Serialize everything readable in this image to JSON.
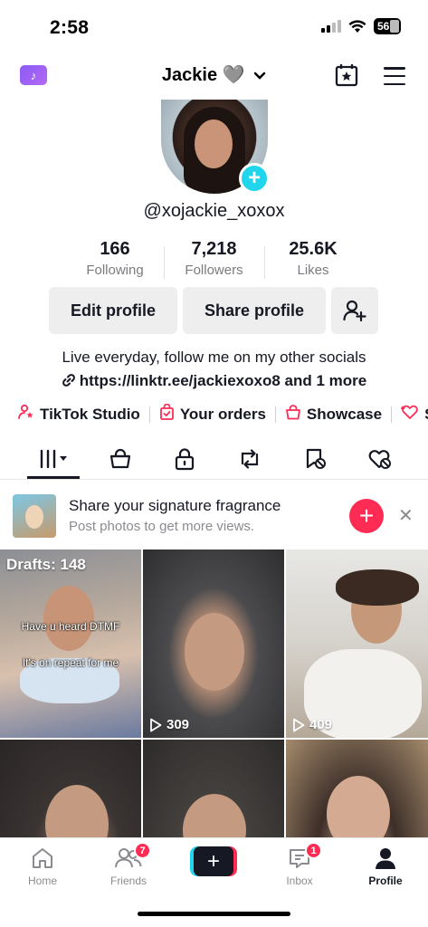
{
  "status": {
    "time": "2:58",
    "battery": "56"
  },
  "header": {
    "name": "Jackie",
    "heart": "🩶"
  },
  "profile": {
    "username": "@xojackie_xoxox",
    "stats": [
      {
        "value": "166",
        "label": "Following"
      },
      {
        "value": "7,218",
        "label": "Followers"
      },
      {
        "value": "25.6K",
        "label": "Likes"
      }
    ],
    "edit_label": "Edit profile",
    "share_label": "Share profile",
    "bio": "Live everyday, follow me on my other socials",
    "link": "https://linktr.ee/jackiexoxo8",
    "link_more": "and 1 more"
  },
  "quick_links": [
    "TikTok Studio",
    "Your orders",
    "Showcase",
    "Su"
  ],
  "promo": {
    "title": "Share your signature fragrance",
    "subtitle": "Post photos to get more views."
  },
  "grid": {
    "drafts_label": "Drafts: 148",
    "caption_1": "Have u heard DTMF",
    "caption_2": "It's on repeat for me",
    "views_2": "309",
    "views_3": "409"
  },
  "nav": {
    "home": "Home",
    "friends": "Friends",
    "friends_badge": "7",
    "inbox": "Inbox",
    "inbox_badge": "1",
    "profile": "Profile"
  },
  "colors": {
    "accent": "#fe2c55",
    "cyan": "#20d5ec",
    "text": "#161823"
  }
}
